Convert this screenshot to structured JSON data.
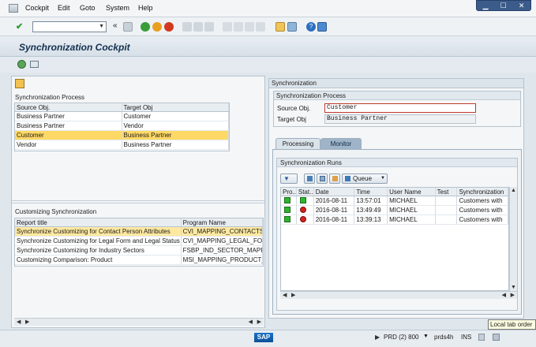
{
  "menu": {
    "items": [
      "Cockpit",
      "Edit",
      "Goto",
      "System",
      "Help"
    ]
  },
  "window_controls": {
    "minimize": "▁",
    "maximize": "☐",
    "close": "✕"
  },
  "toolbar": {
    "back_label": "«"
  },
  "title": "Synchronization Cockpit",
  "left_panel": {
    "process_header": "Synchronization Process",
    "process_columns": [
      "Source Obj.",
      "Target Obj"
    ],
    "process_rows": [
      [
        "Business Partner",
        "Customer"
      ],
      [
        "Business Partner",
        "Vendor"
      ],
      [
        "Customer",
        "Business Partner"
      ],
      [
        "Vendor",
        "Business Partner"
      ]
    ],
    "customizing_header": "Customizing Synchronization",
    "customizing_columns": [
      "Report title",
      "Program Name"
    ],
    "customizing_rows": [
      [
        "Synchronize Customizing for Contact Person Attributes",
        "CVI_MAPPING_CONTACTS"
      ],
      [
        "Synchronize Customizing for Legal Form and Legal Status",
        "CVI_MAPPING_LEGAL_FORM"
      ],
      [
        "Synchronize Customizing for Industry Sectors",
        "FSBP_IND_SECTOR_MAPPIN"
      ],
      [
        "Customizing Comparison: Product",
        "MSI_MAPPING_PRODUCT_C"
      ]
    ]
  },
  "right_panel": {
    "header": "Synchronization",
    "process_group": "Synchronization Process",
    "source_label": "Source Obj.",
    "source_value": "Customer",
    "target_label": "Target Obj",
    "target_value": "Business Partner",
    "tabs": [
      "Processing",
      "Monitor"
    ],
    "runs_header": "Synchronization Runs",
    "queue_label": "Queue",
    "runs_columns": [
      "Pro...",
      "Stat...",
      "Date",
      "Time",
      "User Name",
      "Test",
      "Synchronization"
    ],
    "runs_rows": [
      {
        "date": "2016-08-11",
        "time": "13:57:01",
        "user": "MICHAEL",
        "test": "",
        "desc": "Customers with"
      },
      {
        "date": "2016-08-11",
        "time": "13:49:49",
        "user": "MICHAEL",
        "test": "",
        "desc": "Customers with"
      },
      {
        "date": "2016-08-11",
        "time": "13:39:13",
        "user": "MICHAEL",
        "test": "",
        "desc": "Customers with"
      }
    ]
  },
  "tooltip": "Local tab order",
  "status": {
    "logo": "SAP",
    "system": "PRD (2) 800",
    "server": "prds4h",
    "mode": "INS"
  },
  "colors": {
    "accent": "#3b5b8a",
    "selected_row": "#ffd966",
    "light_green": "#2db52d",
    "light_red": "#d42020"
  }
}
